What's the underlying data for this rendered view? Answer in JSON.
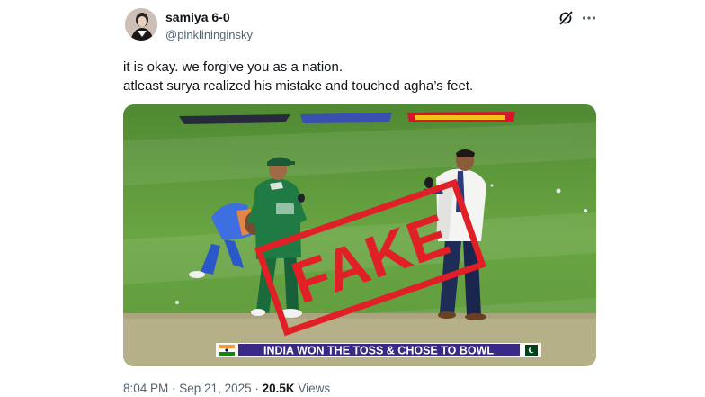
{
  "author": {
    "display_name": "samiya 6-0",
    "handle": "@pinklininginsky"
  },
  "icons": {
    "grok": "grok-icon",
    "more": "more-icon"
  },
  "tweet": {
    "lines": [
      "it is okay. we forgive you as a nation.",
      "atleast surya realized his mistake and touched agha’s feet."
    ]
  },
  "media": {
    "watermark": "FAKE",
    "broadcast_caption": "INDIA WON THE TOSS & CHOSE TO BOWL"
  },
  "meta": {
    "time": "8:04 PM",
    "sep1": " · ",
    "date": "Sep 21, 2025",
    "sep2": " · ",
    "views_count": "20.5K",
    "views_label": " Views"
  },
  "colors": {
    "handle_gray": "#536471",
    "text": "#0f1419",
    "stamp_red": "#e01f26",
    "pitch_green": "#5f9c3a"
  }
}
